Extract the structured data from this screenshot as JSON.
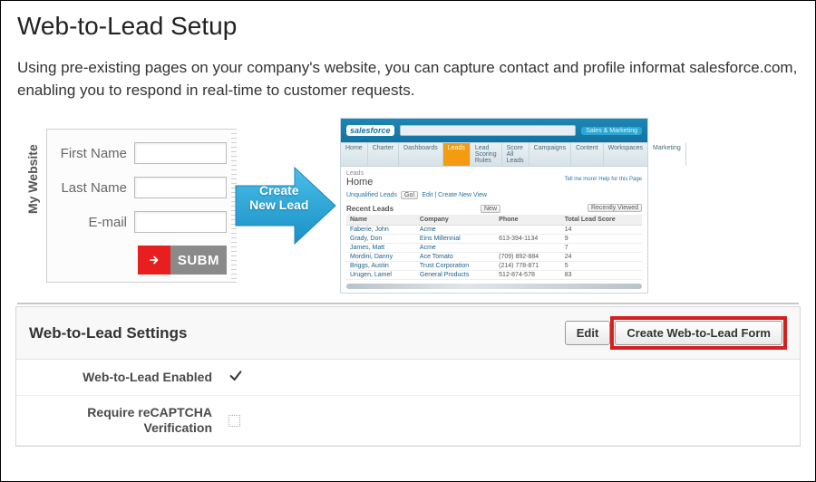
{
  "page": {
    "title": "Web-to-Lead Setup",
    "intro": "Using pre-existing pages on your company's website, you can capture contact and profile informat salesforce.com, enabling you to respond in real-time to customer requests."
  },
  "illustration": {
    "mywebsite_label": "My Website",
    "form": {
      "first_name_label": "First Name",
      "last_name_label": "Last Name",
      "email_label": "E-mail",
      "submit_label": "SUBM"
    },
    "arrow_label_line1": "Create",
    "arrow_label_line2": "New Lead",
    "salesforce": {
      "logo": "salesforce",
      "chip": "Sales & Marketing",
      "tabs": [
        "Home",
        "Charter",
        "Dashboards",
        "Leads",
        "Lead Scoring Rules",
        "Score All Leads",
        "Campaigns",
        "Content",
        "Workspaces",
        "Marketing"
      ],
      "active_tab_index": 3,
      "breadcrumb": "Leads",
      "page_name": "Home",
      "view_label": "Unqualified Leads",
      "go_btn": "Go!",
      "edit_link": "Edit | Create New View",
      "helper": "Tell me more! Help for this Page",
      "section_title": "Recent Leads",
      "new_btn": "New",
      "recently_viewed": "Recently Viewed",
      "columns": [
        "Name",
        "Company",
        "Phone",
        "Total Lead Score"
      ],
      "rows": [
        {
          "name": "Faberie, John",
          "company": "Acme",
          "phone": "",
          "score": "14"
        },
        {
          "name": "Grady, Don",
          "company": "Eins Millennial",
          "phone": "613-394-1134",
          "score": "9"
        },
        {
          "name": "James, Matt",
          "company": "Acme",
          "phone": "",
          "score": "7"
        },
        {
          "name": "Mordini, Danny",
          "company": "Ace Tomato",
          "phone": "(709) 892-884",
          "score": "24"
        },
        {
          "name": "Briggs, Austin",
          "company": "Trust Corporation",
          "phone": "(214) 778-871",
          "score": "5"
        },
        {
          "name": "Urugen, Lamel",
          "company": "General Products",
          "phone": "512-874-578",
          "score": "83"
        }
      ]
    }
  },
  "settings": {
    "heading": "Web-to-Lead Settings",
    "edit_button": "Edit",
    "create_button": "Create Web-to-Lead Form",
    "rows": {
      "enabled": {
        "label": "Web-to-Lead Enabled",
        "checked": true
      },
      "recaptcha": {
        "label": "Require reCAPTCHA Verification",
        "checked": false
      }
    }
  }
}
